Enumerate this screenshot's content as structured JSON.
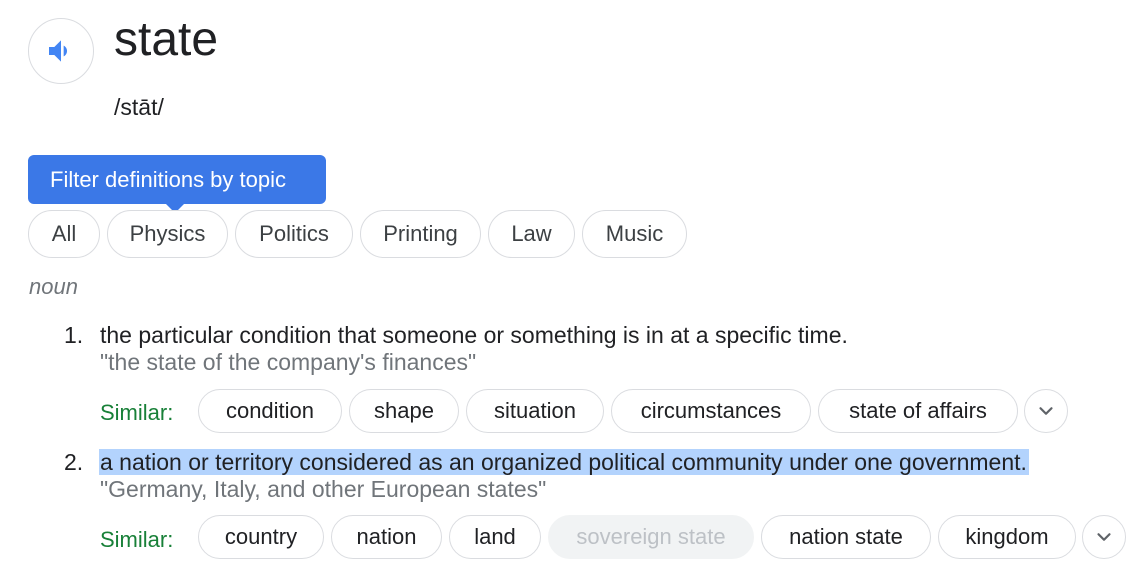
{
  "header": {
    "word": "state",
    "phonetic": "/stāt/",
    "speaker_icon": "volume-up-icon"
  },
  "tooltip": {
    "text": "Filter definitions by topic"
  },
  "topics": [
    {
      "label": "All"
    },
    {
      "label": "Physics"
    },
    {
      "label": "Politics"
    },
    {
      "label": "Printing"
    },
    {
      "label": "Law"
    },
    {
      "label": "Music"
    }
  ],
  "part_of_speech": "noun",
  "definitions": [
    {
      "number": "1.",
      "text": "the particular condition that someone or something is in at a specific time.",
      "example": "\"the state of the company's finances\"",
      "similar_label": "Similar:",
      "similar": [
        {
          "label": "condition",
          "muted": false
        },
        {
          "label": "shape",
          "muted": false
        },
        {
          "label": "situation",
          "muted": false
        },
        {
          "label": "circumstances",
          "muted": false
        },
        {
          "label": "state of affairs",
          "muted": false
        }
      ],
      "more_icon": "chevron-down-icon"
    },
    {
      "number": "2.",
      "text": "a nation or territory considered as an organized political community under one government.",
      "highlighted": true,
      "example": "\"Germany, Italy, and other European states\"",
      "similar_label": "Similar:",
      "similar": [
        {
          "label": "country",
          "muted": false
        },
        {
          "label": "nation",
          "muted": false
        },
        {
          "label": "land",
          "muted": false
        },
        {
          "label": "sovereign state",
          "muted": true
        },
        {
          "label": "nation state",
          "muted": false
        },
        {
          "label": "kingdom",
          "muted": false
        }
      ],
      "more_icon": "chevron-down-icon"
    }
  ],
  "colors": {
    "tooltip_bg": "#3b78e7",
    "similar_label": "#188038",
    "highlight": "#b3d3fd",
    "example_text": "#70757a",
    "speaker_icon": "#4285f4"
  }
}
